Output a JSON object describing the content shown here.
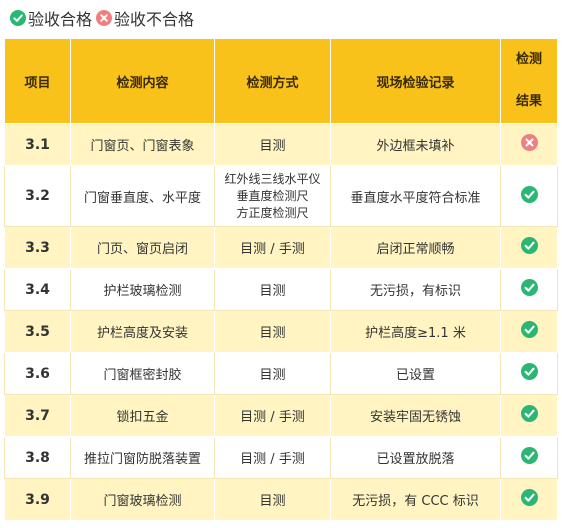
{
  "legend": {
    "pass_label": "验收合格",
    "fail_label": "验收不合格",
    "pass_icon": "check-circle-icon",
    "fail_icon": "x-circle-icon",
    "pass_color": "#2bb673",
    "fail_color": "#f08080"
  },
  "table": {
    "headers": {
      "item": "项目",
      "content": "检测内容",
      "method": "检测方式",
      "record": "现场检验记录",
      "result_line1": "检测",
      "result_line2": "结果"
    },
    "header_color": "#f9c21b",
    "stripe_color": "#fff4c2",
    "rows": [
      {
        "item": "3.1",
        "content": "门窗页、门窗表象",
        "method": "目测",
        "record": "外边框未填补",
        "result": "fail"
      },
      {
        "item": "3.2",
        "content": "门窗垂直度、水平度",
        "method_lines": [
          "红外线三线水平仪",
          "垂直度检测尺",
          "方正度检测尺"
        ],
        "record": "垂直度水平度符合标准",
        "result": "pass"
      },
      {
        "item": "3.3",
        "content": "门页、窗页启闭",
        "method": "目测 / 手测",
        "record": "启闭正常顺畅",
        "result": "pass"
      },
      {
        "item": "3.4",
        "content": "护栏玻璃检测",
        "method": "目测",
        "record": "无污损，有标识",
        "result": "pass"
      },
      {
        "item": "3.5",
        "content": "护栏高度及安装",
        "method": "目测",
        "record": "护栏高度≥1.1 米",
        "result": "pass"
      },
      {
        "item": "3.6",
        "content": "门窗框密封胶",
        "method": "目测",
        "record": "已设置",
        "result": "pass"
      },
      {
        "item": "3.7",
        "content": "锁扣五金",
        "method": "目测 / 手测",
        "record": "安装牢固无锈蚀",
        "result": "pass"
      },
      {
        "item": "3.8",
        "content": "推拉门窗防脱落装置",
        "method": "目测 / 手测",
        "record": "已设置放脱落",
        "result": "pass"
      },
      {
        "item": "3.9",
        "content": "门窗玻璃检测",
        "method": "目测",
        "record": "无污损，有 CCC 标识",
        "result": "pass"
      }
    ]
  }
}
